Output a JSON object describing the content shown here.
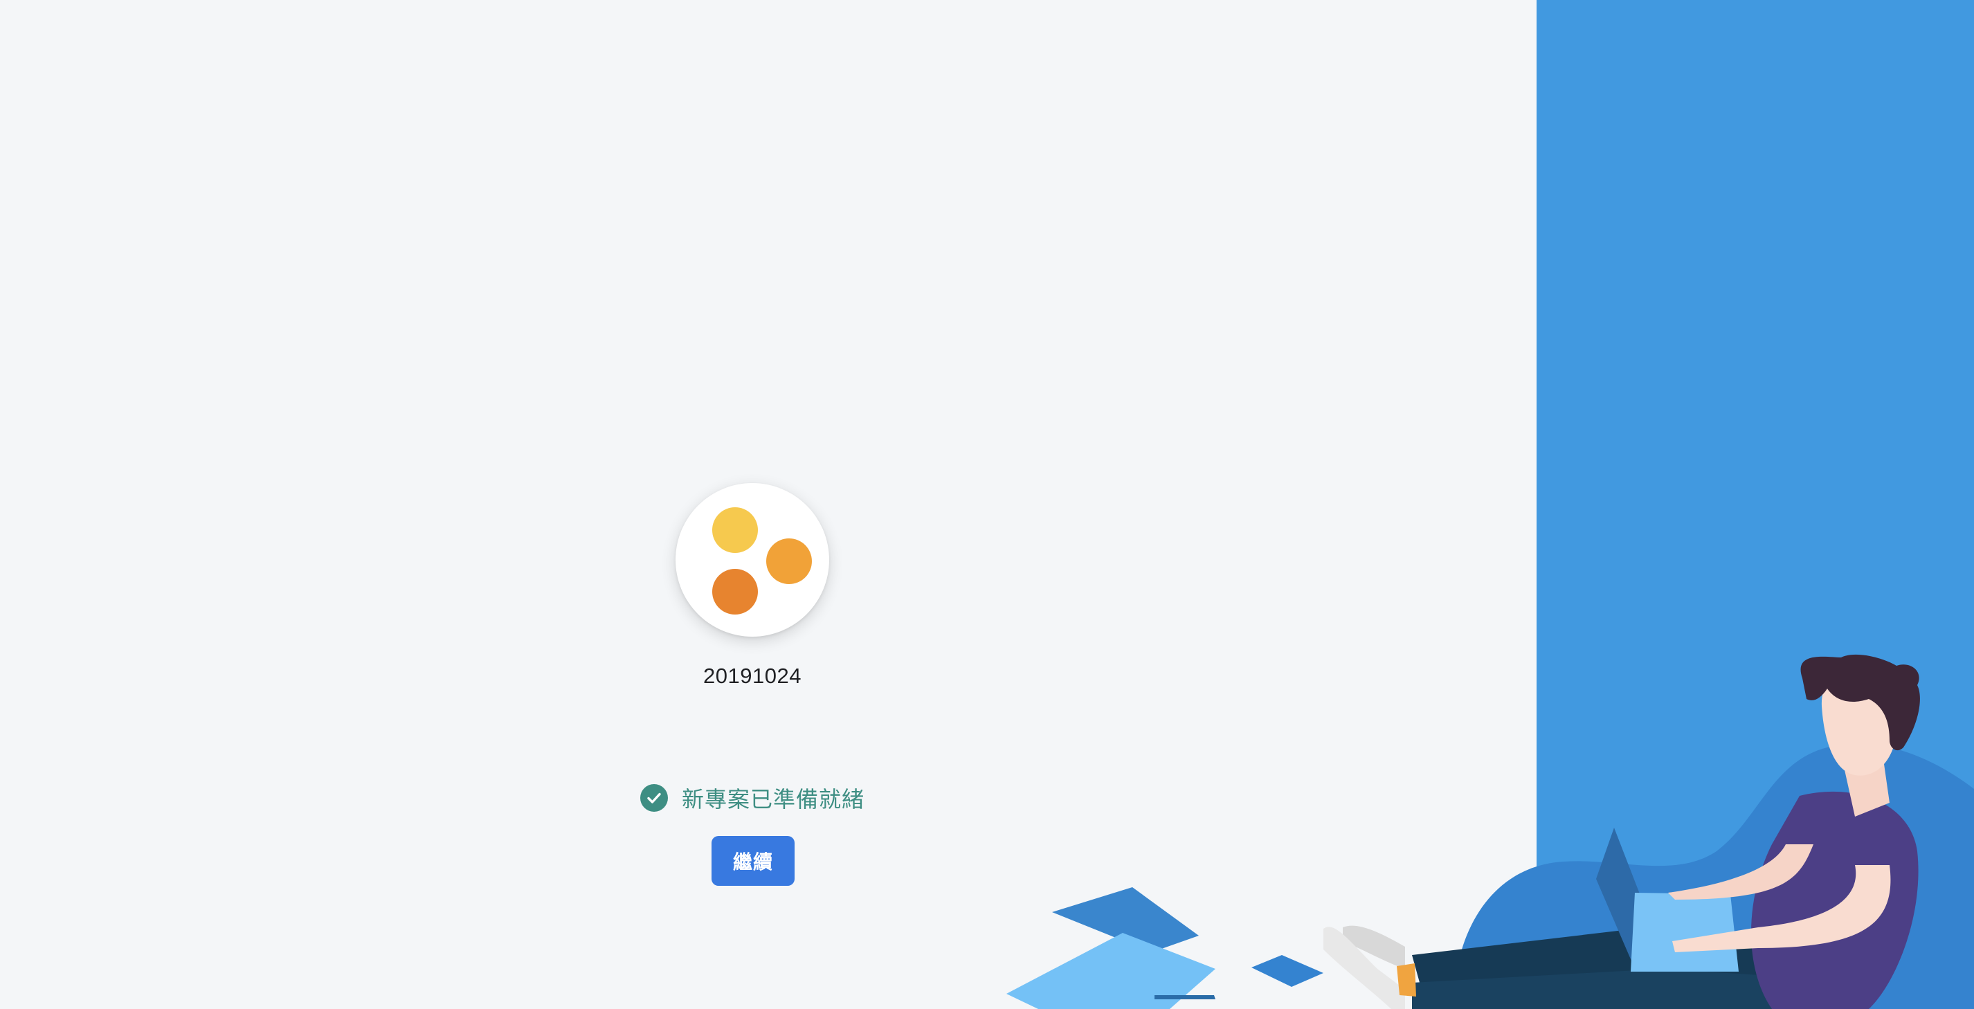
{
  "project": {
    "name": "20191024",
    "logo_colors": [
      "#f6c94e",
      "#f1a238",
      "#e7842f"
    ]
  },
  "status": {
    "message": "新專案已準備就緒",
    "icon": "check-circle-icon",
    "color": "#3e8e83"
  },
  "actions": {
    "continue_label": "繼續",
    "continue_color": "#3879e0"
  },
  "illustration": {
    "description_icon": "person-with-laptop-illustration",
    "panel_color": "#4199e0"
  }
}
